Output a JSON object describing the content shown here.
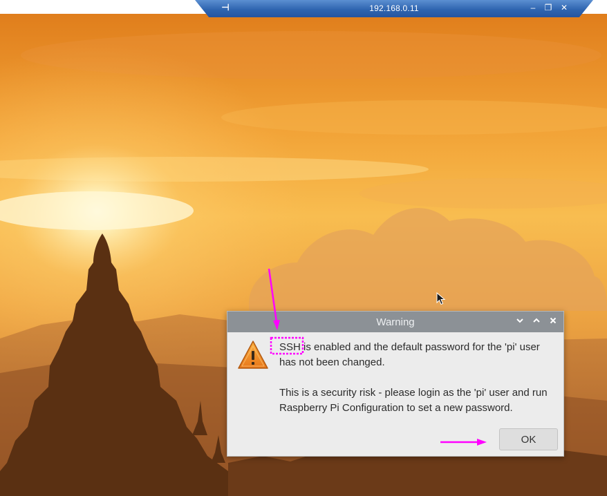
{
  "remote_bar": {
    "host": "192.168.0.11",
    "pin_icon": "pin-icon",
    "minimize_icon": "minimize-icon",
    "restore_icon": "restore-icon",
    "close_icon": "close-icon",
    "color": "#2f65b0"
  },
  "dialog": {
    "title": "Warning",
    "title_buttons": [
      "chevron-down-icon",
      "chevron-up-icon",
      "close-icon"
    ],
    "icon": "warning-triangle-icon",
    "message_1": "SSH is enabled and the default password for the 'pi' user has not been changed.",
    "message_2": "This is a security risk - please login as the 'pi' user and run Raspberry Pi Configuration to set a new password.",
    "ok_label": "OK"
  },
  "annotations": {
    "color": "#ff00ff",
    "items": [
      "arrow-to-ssh",
      "highlight-box-ssh",
      "arrow-to-ok-button"
    ]
  },
  "colors": {
    "title_bar": "#8c9196",
    "dialog_bg": "#ececec",
    "warning_orange": "#f0901e"
  }
}
